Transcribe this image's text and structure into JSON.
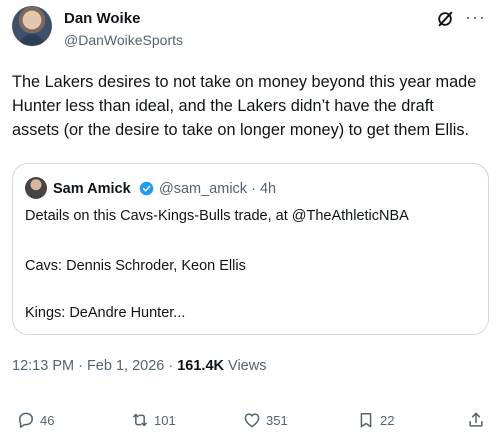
{
  "author": {
    "name": "Dan Woike",
    "handle": "@DanWoikeSports"
  },
  "tweet": {
    "text": "The Lakers desires to not take on money beyond this year made Hunter less than ideal, and the Lakers didn’t have the draft assets (or the desire to take on longer money) to get them Ellis."
  },
  "quote": {
    "name": "Sam Amick",
    "handle": "@sam_amick",
    "separator": "·",
    "age": "4h",
    "lines": [
      "Details on this Cavs-Kings-Bulls trade, at @TheAthleticNBA",
      "Cavs: Dennis Schroder, Keon Ellis",
      "Kings: DeAndre Hunter..."
    ]
  },
  "meta": {
    "time": "12:13 PM · Feb 1, 2026 · ",
    "views_count": "161.4K",
    "views_label": " Views"
  },
  "actions": {
    "replies": "46",
    "reposts": "101",
    "likes": "351",
    "bookmarks": "22"
  },
  "icons": [
    "grok-icon",
    "more-icon",
    "verified-icon",
    "reply-icon",
    "repost-icon",
    "like-icon",
    "bookmark-icon",
    "share-icon"
  ],
  "colors": {
    "text": "#0f1419",
    "secondary": "#536471",
    "verified": "#1d9bf0",
    "border": "#cfd9de"
  }
}
